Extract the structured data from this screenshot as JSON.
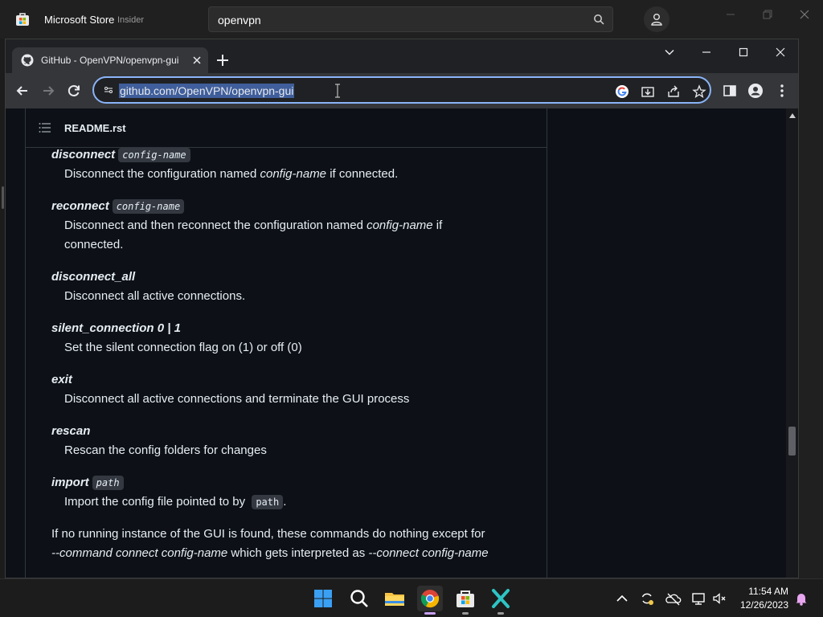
{
  "store": {
    "title": "Microsoft Store",
    "badge": "Insider",
    "search_value": "openvpn",
    "icons": [
      "store-logo-icon",
      "search-icon",
      "account-icon",
      "minimize-icon",
      "maximize-icon",
      "close-icon"
    ]
  },
  "browser": {
    "tab_title": "GitHub - OpenVPN/openvpn-gui",
    "url": "github.com/OpenVPN/openvpn-gui",
    "accent": "#8ab4f8"
  },
  "readme": {
    "filename": "README.rst",
    "entries": [
      {
        "term": "disconnect",
        "arg": "config-name",
        "desc_a": "Disconnect the configuration named ",
        "desc_em": "config-name",
        "desc_b": " if connected."
      },
      {
        "term": "reconnect",
        "arg": "config-name",
        "desc_a": "Disconnect and then reconnect the configuration named ",
        "desc_em": "config-name",
        "desc_b": " if",
        "desc_line2": "connected."
      },
      {
        "term": "disconnect_all",
        "desc": "Disconnect all active connections."
      },
      {
        "term": "silent_connection 0 | 1",
        "desc": "Set the silent connection flag on (1) or off (0)"
      },
      {
        "term": "exit",
        "desc": "Disconnect all active connections and terminate the GUI process"
      },
      {
        "term": "rescan",
        "desc": "Rescan the config folders for changes"
      },
      {
        "term": "import",
        "arg": "path",
        "desc_a": "Import the config file pointed to by ",
        "desc_code": "path",
        "desc_b": "."
      }
    ],
    "footer_line1": "If no running instance of the GUI is found, these commands do nothing except for",
    "footer_line2_em1": "--command connect config-name",
    "footer_line2_mid": " which gets interpreted as ",
    "footer_line2_em2": "--connect config-name"
  },
  "taskbar": {
    "time": "11:54 AM",
    "date": "12/26/2023",
    "apps": [
      "start-icon",
      "search-icon",
      "file-explorer-icon",
      "chrome-icon",
      "store-icon",
      "vpn-app-icon"
    ]
  }
}
